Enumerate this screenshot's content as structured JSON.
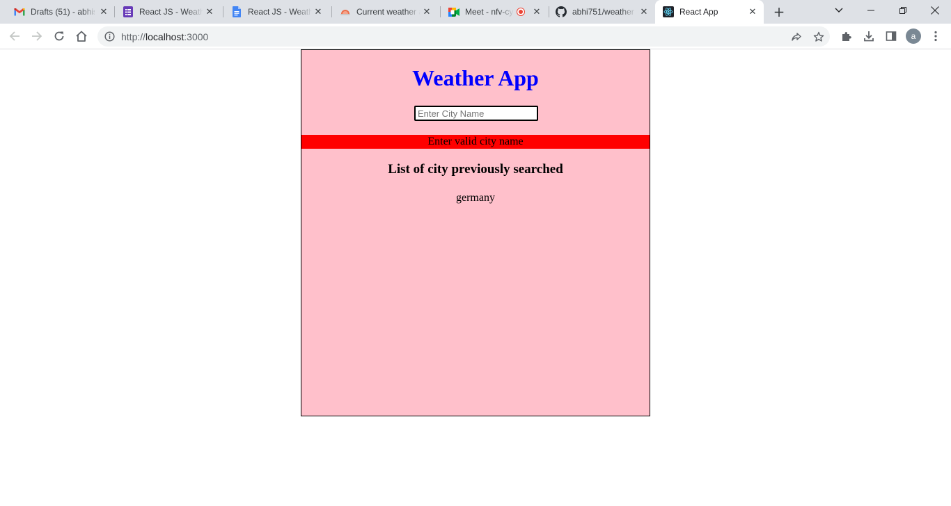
{
  "browser": {
    "tabs": [
      {
        "title": "Drafts (51) - abhis",
        "icon": "gmail-icon",
        "active": false
      },
      {
        "title": "React JS - Weathe",
        "icon": "forms-icon",
        "active": false
      },
      {
        "title": "React JS - Weathe",
        "icon": "docs-icon",
        "active": false
      },
      {
        "title": "Current weather a",
        "icon": "openweather-icon",
        "active": false
      },
      {
        "title": "Meet - nfv-cy",
        "icon": "meet-icon",
        "active": false
      },
      {
        "title": "abhi751/weather",
        "icon": "github-icon",
        "active": false
      },
      {
        "title": "React App",
        "icon": "react-icon",
        "active": true
      }
    ],
    "url_prefix": "http://",
    "url_host": "localhost",
    "url_rest": ":3000",
    "profile_initial": "a"
  },
  "app": {
    "title": "Weather App",
    "search": {
      "placeholder": "Enter City Name",
      "value": ""
    },
    "error_message": "Enter valid city name",
    "history_heading": "List of city previously searched",
    "history": [
      "germany"
    ]
  },
  "colors": {
    "app_background": "#ffc0cb",
    "title": "#0000ff",
    "error_background": "#ff0000"
  }
}
